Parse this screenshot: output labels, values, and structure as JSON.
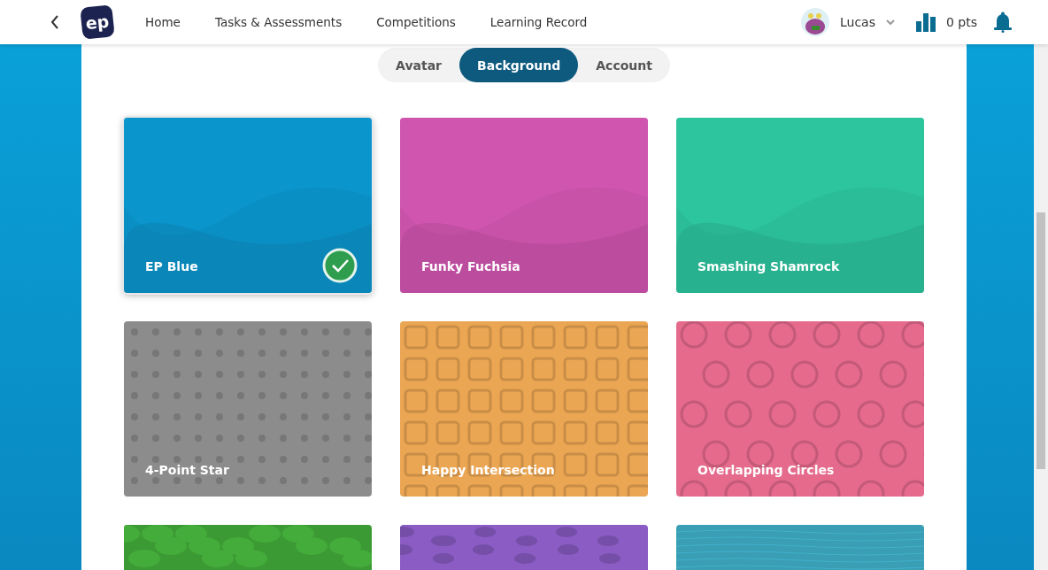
{
  "nav": {
    "links": [
      "Home",
      "Tasks & Assessments",
      "Competitions",
      "Learning Record"
    ],
    "logo": "ep",
    "user": "Lucas",
    "points": "0 pts"
  },
  "tabs": [
    {
      "label": "Avatar",
      "selected": false
    },
    {
      "label": "Background",
      "selected": true
    },
    {
      "label": "Account",
      "selected": false
    }
  ],
  "backgrounds": [
    {
      "name": "EP Blue",
      "kind": "gradient",
      "color": "#0a8fc4",
      "selected": true
    },
    {
      "name": "Funky Fuchsia",
      "kind": "gradient",
      "color": "#c852a8",
      "selected": false
    },
    {
      "name": "Smashing Shamrock",
      "kind": "gradient",
      "color": "#2bbd98",
      "selected": false
    },
    {
      "name": "4-Point Star",
      "kind": "stars",
      "color": "#8c8c8c",
      "selected": false
    },
    {
      "name": "Happy Intersection",
      "kind": "maze",
      "color": "#eba653",
      "selected": false
    },
    {
      "name": "Overlapping Circles",
      "kind": "circles",
      "color": "#e56a8c",
      "selected": false
    },
    {
      "kind": "blobs",
      "color": "#3c9a34",
      "selected": false
    },
    {
      "kind": "speckle",
      "color": "#8a5cc4",
      "selected": false
    },
    {
      "kind": "water",
      "color": "#3a9eb4",
      "selected": false
    }
  ]
}
